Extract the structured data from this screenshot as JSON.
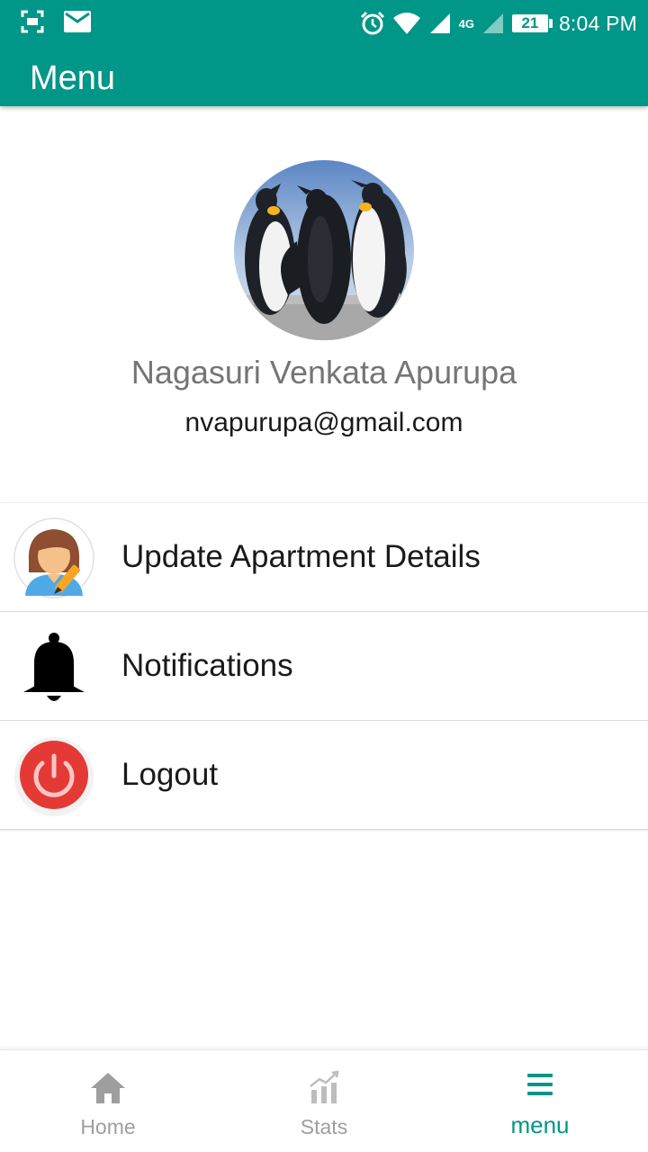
{
  "status_bar": {
    "battery": "21",
    "time": "8:04 PM",
    "network_label": "4G"
  },
  "app_bar": {
    "title": "Menu"
  },
  "profile": {
    "name": "Nagasuri Venkata Apurupa",
    "email": "nvapurupa@gmail.com"
  },
  "menu": {
    "items": [
      {
        "label": "Update Apartment Details",
        "icon": "person-edit-icon"
      },
      {
        "label": "Notifications",
        "icon": "bell-icon"
      },
      {
        "label": "Logout",
        "icon": "power-icon"
      }
    ]
  },
  "bottom_nav": {
    "items": [
      {
        "label": "Home",
        "icon": "home-icon",
        "active": false
      },
      {
        "label": "Stats",
        "icon": "chart-icon",
        "active": false
      },
      {
        "label": "menu",
        "icon": "menu-icon",
        "active": true
      }
    ]
  },
  "colors": {
    "primary": "#009688",
    "inactive": "#9e9e9e",
    "logout_red": "#e53935"
  }
}
